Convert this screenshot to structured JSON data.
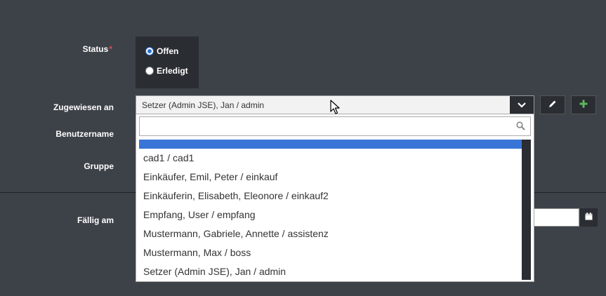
{
  "form": {
    "status_label": "Status",
    "required_mark": "*",
    "status_options": [
      {
        "label": "Offen",
        "checked": true
      },
      {
        "label": "Erledigt",
        "checked": false
      }
    ],
    "assigned_label": "Zugewiesen an",
    "assigned_value": "Setzer (Admin JSE), Jan / admin",
    "username_label": "Benutzername",
    "group_label": "Gruppe",
    "due_label": "Fällig am"
  },
  "dropdown": {
    "search_value": "",
    "items": [
      "",
      "cad1 / cad1",
      "Einkäufer, Emil, Peter / einkauf",
      "Einkäuferin, Elisabeth, Eleonore / einkauf2",
      "Empfang, User / empfang",
      "Mustermann, Gabriele, Annette / assistenz",
      "Mustermann, Max / boss",
      "Setzer (Admin JSE), Jan / admin"
    ]
  },
  "icons": {
    "edit": "pencil-icon",
    "add": "plus-icon",
    "calendar": "calendar-icon",
    "search": "search-icon",
    "arrow": "chevron-down-icon"
  },
  "colors": {
    "background": "#3d4148",
    "highlight": "#3875d7",
    "add_green": "#5cb85c",
    "required": "#d9534f"
  }
}
